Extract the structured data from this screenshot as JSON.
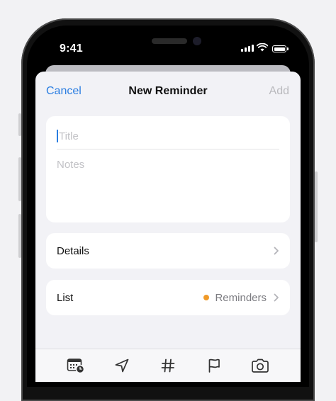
{
  "status_bar": {
    "time": "9:41"
  },
  "nav": {
    "cancel_label": "Cancel",
    "title": "New Reminder",
    "add_label": "Add"
  },
  "form": {
    "title_placeholder": "Title",
    "notes_placeholder": "Notes"
  },
  "rows": {
    "details_label": "Details",
    "list_label": "List",
    "list_value": "Reminders",
    "list_color": "#f09a28"
  },
  "toolbar": {
    "icons": [
      "calendar-clock-icon",
      "location-icon",
      "hashtag-icon",
      "flag-icon",
      "camera-icon"
    ]
  },
  "colors": {
    "accent": "#2a7de1",
    "disabled": "#b9b9bd"
  }
}
